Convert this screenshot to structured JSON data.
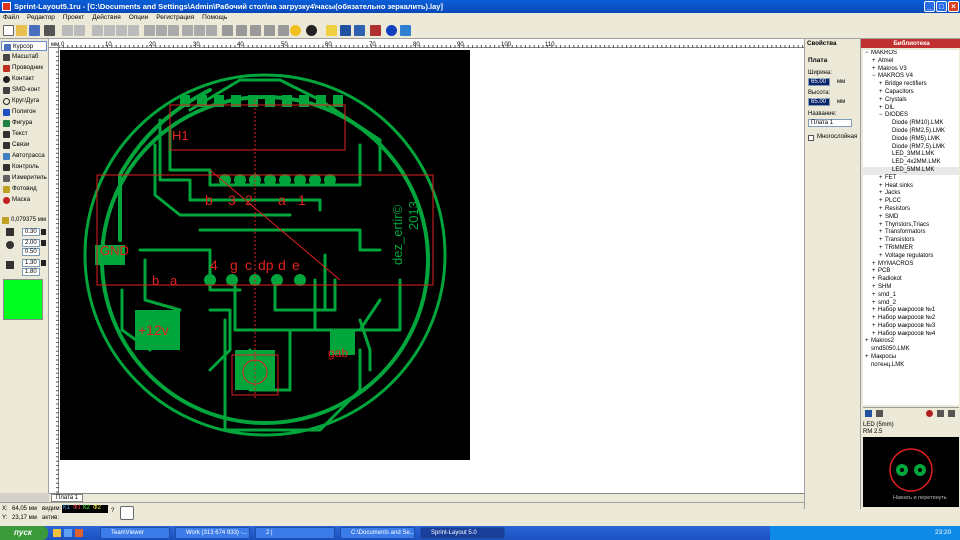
{
  "window": {
    "title": "Sprint-Layout5.1ru - [C:\\Documents and Settings\\Admin\\Рабочий стол\\на загрузку4\\часы(обязательно зеркалить).lay]",
    "min": "_",
    "max": "□",
    "close": "×"
  },
  "menu": [
    "Файл",
    "Редактор",
    "Проект",
    "Действия",
    "Опции",
    "Регистрация",
    "Помощь"
  ],
  "tools": [
    {
      "label": "Курсор",
      "active": true,
      "color": "#4a6fbf"
    },
    {
      "label": "Масштаб",
      "color": "#444"
    },
    {
      "label": "Проводник",
      "color": "#c03020"
    },
    {
      "label": "Контакт",
      "color": "#202020"
    },
    {
      "label": "SMD-конт",
      "color": "#404040"
    },
    {
      "label": "Круг/Дуга",
      "color": "#202020"
    },
    {
      "label": "Полигон",
      "color": "#2050c0"
    },
    {
      "label": "Фигура",
      "color": "#208040"
    },
    {
      "label": "Текст",
      "color": "#303030"
    },
    {
      "label": "Связи",
      "color": "#303030"
    },
    {
      "label": "Автотрасса",
      "color": "#4080c0"
    },
    {
      "label": "Контроль",
      "color": "#303030"
    },
    {
      "label": "Измеритель",
      "color": "#606060"
    },
    {
      "label": "Фотовид",
      "color": "#c0a020"
    },
    {
      "label": "Маска",
      "color": "#c02020"
    }
  ],
  "grid": "0,079375 мм",
  "sizes": [
    "0.30",
    "2.00",
    "0.50",
    "1.30",
    "1.80"
  ],
  "ruler": {
    "top": [
      "мм",
      "0",
      "10",
      "20",
      "30",
      "40",
      "50",
      "60",
      "70",
      "80",
      "90",
      "100",
      "110"
    ],
    "left": [
      "0",
      "10",
      "20",
      "30",
      "40",
      "50",
      "60",
      "70",
      "80",
      "90",
      "100",
      "110"
    ]
  },
  "board_labels": {
    "gnd": "GND",
    "v12": "+12v",
    "gab": "gab",
    "date": "2013",
    "author": "dez_ertir©",
    "digits": [
      "4",
      "g",
      "c",
      "dp",
      "d",
      "e"
    ],
    "top_digits": [
      "b",
      "3",
      "2",
      "a",
      "1"
    ],
    "left_a": "a",
    "left_b": "b",
    "h1": "H1"
  },
  "page_tab": "Плата 1",
  "status": {
    "x": "64,05 мм",
    "y": "23,17 мм",
    "x_label": "X:",
    "y_label": "Y:",
    "visible_label": "видим:",
    "active_label": "актив:",
    "layers": [
      "К1",
      "Ф1",
      "К2",
      "Ф2"
    ],
    "help": "?"
  },
  "props": {
    "tab": "Свойства",
    "title": "Плата",
    "width_label": "Ширина:",
    "width": "65.00",
    "unit": "мм",
    "height_label": "Высота:",
    "height": "65.00",
    "name_label": "Название:",
    "name": "Плата 1",
    "multilayer": "Многослойная"
  },
  "library": {
    "tab": "Библиотека",
    "items": [
      {
        "t": "MAKROS",
        "d": 0,
        "s": "−"
      },
      {
        "t": "Atmel",
        "d": 1,
        "s": "+"
      },
      {
        "t": "Makros V3",
        "d": 1,
        "s": "+"
      },
      {
        "t": "MAKROS V4",
        "d": 1,
        "s": "−"
      },
      {
        "t": "Bridge rectifiers",
        "d": 2,
        "s": "+"
      },
      {
        "t": "Capacitors",
        "d": 2,
        "s": "+"
      },
      {
        "t": "Crystals",
        "d": 2,
        "s": "+"
      },
      {
        "t": "DIL",
        "d": 2,
        "s": "+"
      },
      {
        "t": "DIODES",
        "d": 2,
        "s": "−"
      },
      {
        "t": "Diode (RM10).LMK",
        "d": 3,
        "s": ""
      },
      {
        "t": "Diode (RM2,5).LMK",
        "d": 3,
        "s": ""
      },
      {
        "t": "Diode (RM5).LMK",
        "d": 3,
        "s": ""
      },
      {
        "t": "Diode (RM7,5).LMK",
        "d": 3,
        "s": ""
      },
      {
        "t": "LED_3MM.LMK",
        "d": 3,
        "s": ""
      },
      {
        "t": "LED_4x2MM.LMK",
        "d": 3,
        "s": ""
      },
      {
        "t": "LED_5MM.LMK",
        "d": 3,
        "s": "",
        "sel": true
      },
      {
        "t": "FET",
        "d": 2,
        "s": "+"
      },
      {
        "t": "Heat sinks",
        "d": 2,
        "s": "+"
      },
      {
        "t": "Jacks",
        "d": 2,
        "s": "+"
      },
      {
        "t": "PLCC",
        "d": 2,
        "s": "+"
      },
      {
        "t": "Resistors",
        "d": 2,
        "s": "+"
      },
      {
        "t": "SMD",
        "d": 2,
        "s": "+"
      },
      {
        "t": "Thyristors,Triacs",
        "d": 2,
        "s": "+"
      },
      {
        "t": "Transformators",
        "d": 2,
        "s": "+"
      },
      {
        "t": "Transistors",
        "d": 2,
        "s": "+"
      },
      {
        "t": "TRIMMER",
        "d": 2,
        "s": "+"
      },
      {
        "t": "Voltage regulators",
        "d": 2,
        "s": "+"
      },
      {
        "t": "MYMACROS",
        "d": 1,
        "s": "+"
      },
      {
        "t": "PCB",
        "d": 1,
        "s": "+"
      },
      {
        "t": "Radiokot",
        "d": 1,
        "s": "+"
      },
      {
        "t": "SHM",
        "d": 1,
        "s": "+"
      },
      {
        "t": "smd_1",
        "d": 1,
        "s": "+"
      },
      {
        "t": "smd_2",
        "d": 1,
        "s": "+"
      },
      {
        "t": "Набор макросов №1",
        "d": 1,
        "s": "+"
      },
      {
        "t": "Набор макросов №2",
        "d": 1,
        "s": "+"
      },
      {
        "t": "Набор макросов №3",
        "d": 1,
        "s": "+"
      },
      {
        "t": "Набор макросов №4",
        "d": 1,
        "s": "+"
      },
      {
        "t": "Makros2",
        "d": 0,
        "s": "+"
      },
      {
        "t": "smd5050.LMK",
        "d": 0,
        "s": ""
      },
      {
        "t": "Макросы",
        "d": 0,
        "s": "+"
      },
      {
        "t": "потенц.LMK",
        "d": 0,
        "s": ""
      }
    ],
    "preview_name": "LED (5mm)",
    "preview_rm": "RM 2.5",
    "preview_hint": "Нажать и перетянуть"
  },
  "taskbar": {
    "start": "пуск",
    "clock": "23:20",
    "tasks": [
      {
        "label": "TeamViewer"
      },
      {
        "label": "Work (313 674 933) -..."
      },
      {
        "label": "2 |"
      },
      {
        "label": "C:\\Documents and Se..."
      },
      {
        "label": "Sprint-Layout 5.0",
        "active": true
      }
    ]
  },
  "colors": {
    "copper": "#00a63c",
    "title_blue": "#0a5fd8",
    "lib_tab": "#c03030",
    "silk": "#e02020"
  }
}
